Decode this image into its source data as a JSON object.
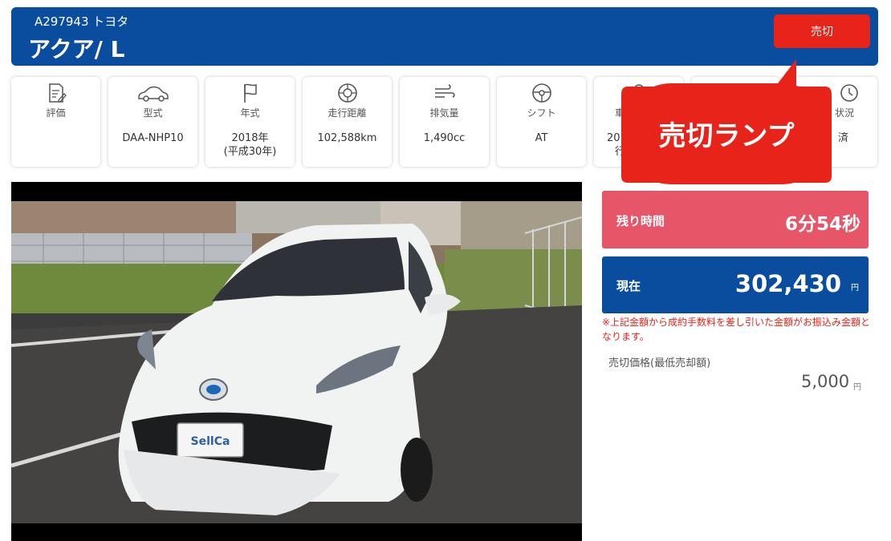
{
  "header": {
    "subtitle": "A297943 トヨタ",
    "title": "アクア/ L",
    "status_button": "売切"
  },
  "specs": [
    {
      "icon": "clipboard-pen-icon",
      "label": "評価",
      "value": "",
      "value2": ""
    },
    {
      "icon": "car-icon",
      "label": "型式",
      "value": "DAA-NHP10",
      "value2": ""
    },
    {
      "icon": "flag-icon",
      "label": "年式",
      "value": "2018年",
      "value2": "(平成30年)"
    },
    {
      "icon": "tire-icon",
      "label": "走行距離",
      "value": "102,588km",
      "value2": ""
    },
    {
      "icon": "wind-icon",
      "label": "排気量",
      "value": "1,490cc",
      "value2": ""
    },
    {
      "icon": "steering-wheel-icon",
      "label": "シフト",
      "value": "AT",
      "value2": ""
    },
    {
      "icon": "pin-icon",
      "label": "車",
      "value": "20",
      "value2": "行"
    },
    {
      "icon": "blank-icon",
      "label": "",
      "value": "",
      "value2": ""
    },
    {
      "icon": "clock-icon",
      "label": "状況",
      "value": "済",
      "value2": ""
    }
  ],
  "callout": {
    "text": "売切ランプ",
    "color": "#e8231a"
  },
  "timer": {
    "label": "残り時間",
    "value": "6分54秒"
  },
  "current_price": {
    "label": "現在",
    "value": "302,430",
    "unit": "円"
  },
  "note": "※上記金額から成約手数料を差し引いた金額がお振込み金額となります。",
  "minimum": {
    "label": "売切価格(最低売却額)",
    "value": "5,000",
    "unit": "円"
  },
  "photo": {
    "plate_text": "SellCa"
  },
  "colors": {
    "brand_blue": "#0a4d9e",
    "red": "#e8231a",
    "timer_pink": "#e65568"
  }
}
